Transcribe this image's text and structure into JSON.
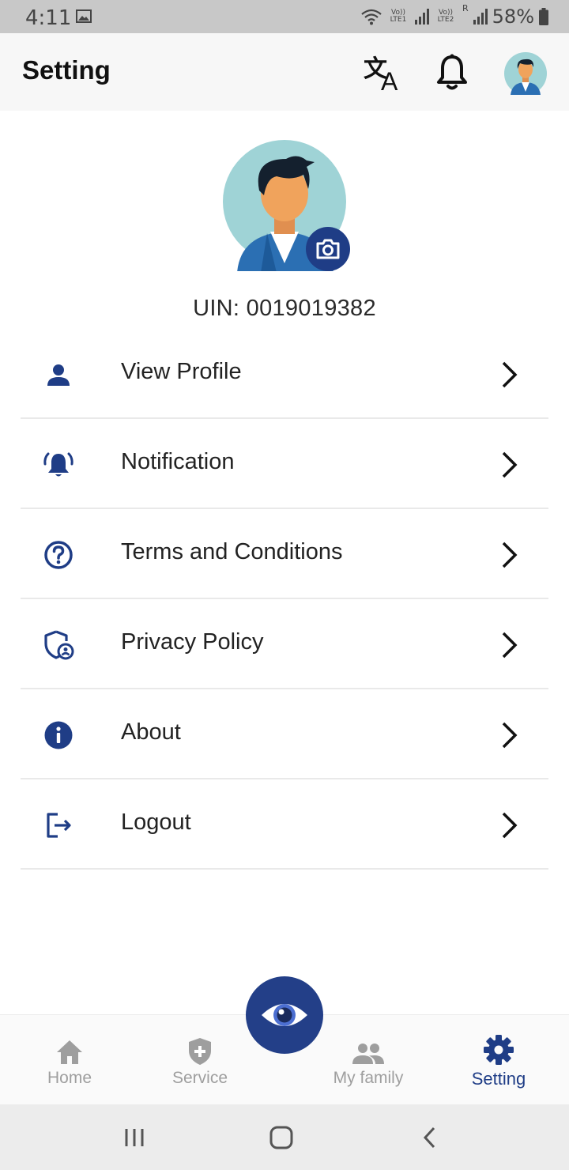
{
  "status_bar": {
    "time": "4:11",
    "sim1_label": "Vo)) LTE1",
    "sim2_label": "Vo)) LTE2",
    "roaming": "R",
    "battery_percent": "58%",
    "icons": [
      "gallery-icon",
      "wifi-icon",
      "signal-icon",
      "battery-icon"
    ]
  },
  "app_bar": {
    "title": "Setting",
    "actions": [
      "translate-icon",
      "bell-icon",
      "avatar"
    ]
  },
  "profile": {
    "uin_text": "UIN: 0019019382"
  },
  "menu": {
    "items": [
      {
        "label": "View Profile",
        "icon": "person-icon"
      },
      {
        "label": "Notification",
        "icon": "alarm-bell-icon"
      },
      {
        "label": "Terms and Conditions",
        "icon": "help-circle-icon"
      },
      {
        "label": "Privacy Policy",
        "icon": "shield-user-icon"
      },
      {
        "label": "About",
        "icon": "info-icon"
      },
      {
        "label": "Logout",
        "icon": "logout-icon"
      }
    ]
  },
  "bottom_nav": {
    "items": [
      {
        "label": "Home",
        "icon": "home-icon"
      },
      {
        "label": "Service",
        "icon": "shield-plus-icon"
      },
      {
        "label": "My family",
        "icon": "group-icon"
      },
      {
        "label": "Setting",
        "icon": "gear-icon"
      }
    ],
    "active": "Setting",
    "center_action_icon": "eye-icon"
  },
  "colors": {
    "primary": "#1f3d86",
    "inactive": "#9e9e9e",
    "status_bar": "#c8c8c8",
    "app_bar": "#f7f7f7",
    "avatar_bg": "#9fd3d6"
  }
}
